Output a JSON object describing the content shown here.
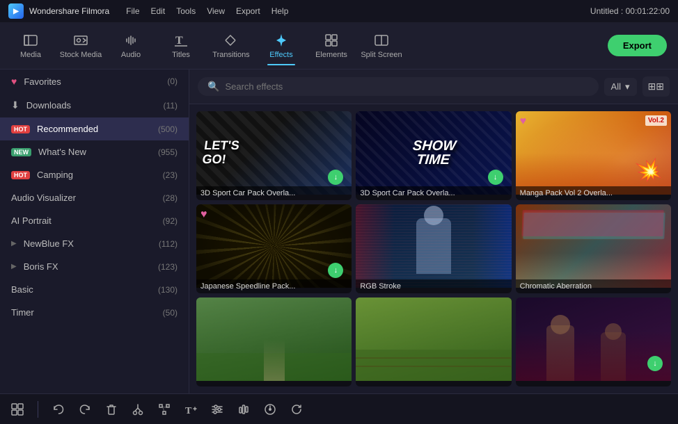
{
  "app": {
    "name": "Wondershare Filmora",
    "title": "Untitled : 00:01:22:00"
  },
  "menu": [
    "File",
    "Edit",
    "Tools",
    "View",
    "Export",
    "Help"
  ],
  "toolbar": {
    "items": [
      {
        "id": "media",
        "label": "Media",
        "icon": "🎬"
      },
      {
        "id": "stock-media",
        "label": "Stock Media",
        "icon": "🎞"
      },
      {
        "id": "audio",
        "label": "Audio",
        "icon": "🎵"
      },
      {
        "id": "titles",
        "label": "Titles",
        "icon": "T"
      },
      {
        "id": "transitions",
        "label": "Transitions",
        "icon": "⤢"
      },
      {
        "id": "effects",
        "label": "Effects",
        "icon": "✦",
        "active": true
      },
      {
        "id": "elements",
        "label": "Elements",
        "icon": "⊞"
      },
      {
        "id": "split-screen",
        "label": "Split Screen",
        "icon": "⊟"
      }
    ],
    "export_label": "Export"
  },
  "sidebar": {
    "items": [
      {
        "id": "favorites",
        "label": "Favorites",
        "count": "(0)",
        "icon": "heart"
      },
      {
        "id": "downloads",
        "label": "Downloads",
        "count": "(11)",
        "icon": "download"
      },
      {
        "id": "recommended",
        "label": "Recommended",
        "count": "(500)",
        "badge": "HOT",
        "badge_type": "hot",
        "active": true
      },
      {
        "id": "whats-new",
        "label": "What's New",
        "count": "(955)",
        "badge": "NEW",
        "badge_type": "new"
      },
      {
        "id": "camping",
        "label": "Camping",
        "count": "(23)",
        "badge": "HOT",
        "badge_type": "hot"
      },
      {
        "id": "audio-visualizer",
        "label": "Audio Visualizer",
        "count": "(28)"
      },
      {
        "id": "ai-portrait",
        "label": "AI Portrait",
        "count": "(92)"
      },
      {
        "id": "newblue-fx",
        "label": "NewBlue FX",
        "count": "(112)",
        "expandable": true
      },
      {
        "id": "boris-fx",
        "label": "Boris FX",
        "count": "(123)",
        "expandable": true
      },
      {
        "id": "basic",
        "label": "Basic",
        "count": "(130)"
      },
      {
        "id": "timer",
        "label": "Timer",
        "count": "(50)"
      }
    ]
  },
  "search": {
    "placeholder": "Search effects",
    "filter": "All"
  },
  "effects": {
    "items": [
      {
        "id": "sport1",
        "label": "3D Sport Car Pack Overla...",
        "thumb_type": "sport1",
        "has_dl": true
      },
      {
        "id": "sport2",
        "label": "3D Sport Car Pack Overla...",
        "thumb_type": "sport2",
        "has_dl": true
      },
      {
        "id": "manga",
        "label": "Manga Pack Vol 2 Overla...",
        "thumb_type": "manga",
        "has_fav": true
      },
      {
        "id": "speedline",
        "label": "Japanese Speedline Pack...",
        "thumb_type": "speedline",
        "has_fav": true,
        "has_dl": true
      },
      {
        "id": "rgb",
        "label": "RGB Stroke",
        "thumb_type": "rgb"
      },
      {
        "id": "chroma",
        "label": "Chromatic Aberration",
        "thumb_type": "chroma"
      },
      {
        "id": "vine1",
        "label": "",
        "thumb_type": "vine1"
      },
      {
        "id": "vine2",
        "label": "",
        "thumb_type": "vine2"
      },
      {
        "id": "color",
        "label": "",
        "thumb_type": "color",
        "has_dl": true
      }
    ]
  },
  "bottom_tools": [
    {
      "id": "scenes",
      "icon": "⊞"
    },
    {
      "id": "undo",
      "icon": "↩"
    },
    {
      "id": "redo",
      "icon": "↪"
    },
    {
      "id": "delete",
      "icon": "🗑"
    },
    {
      "id": "cut",
      "icon": "✂"
    },
    {
      "id": "bezier",
      "icon": "⬡"
    },
    {
      "id": "text",
      "icon": "T+"
    },
    {
      "id": "color",
      "icon": "≡"
    },
    {
      "id": "audio-mix",
      "icon": "⫶"
    },
    {
      "id": "speed",
      "icon": "⊙"
    },
    {
      "id": "loop",
      "icon": "↻"
    }
  ]
}
